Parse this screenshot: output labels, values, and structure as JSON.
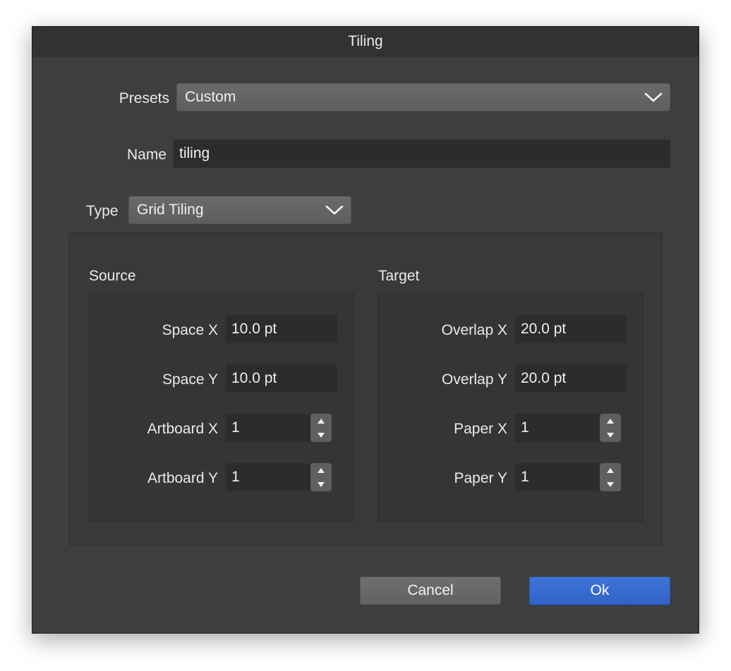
{
  "dialog": {
    "title": "Tiling",
    "presets": {
      "label": "Presets",
      "value": "Custom"
    },
    "name": {
      "label": "Name",
      "value": "tiling"
    },
    "type": {
      "label": "Type",
      "value": "Grid Tiling"
    },
    "source": {
      "heading": "Source",
      "space_x": {
        "label": "Space X",
        "value": "10.0 pt"
      },
      "space_y": {
        "label": "Space Y",
        "value": "10.0 pt"
      },
      "artboard_x": {
        "label": "Artboard X",
        "value": "1"
      },
      "artboard_y": {
        "label": "Artboard Y",
        "value": "1"
      }
    },
    "target": {
      "heading": "Target",
      "overlap_x": {
        "label": "Overlap X",
        "value": "20.0 pt"
      },
      "overlap_y": {
        "label": "Overlap Y",
        "value": "20.0 pt"
      },
      "paper_x": {
        "label": "Paper X",
        "value": "1"
      },
      "paper_y": {
        "label": "Paper Y",
        "value": "1"
      }
    },
    "buttons": {
      "cancel": "Cancel",
      "ok": "Ok"
    },
    "icons": {
      "dropdown": "chevron-down-icon",
      "increment": "triangle-up-icon",
      "decrement": "triangle-down-icon"
    },
    "colors": {
      "primary_button": "#3a6dd2",
      "dialog_bg": "#3e3e3e"
    }
  }
}
